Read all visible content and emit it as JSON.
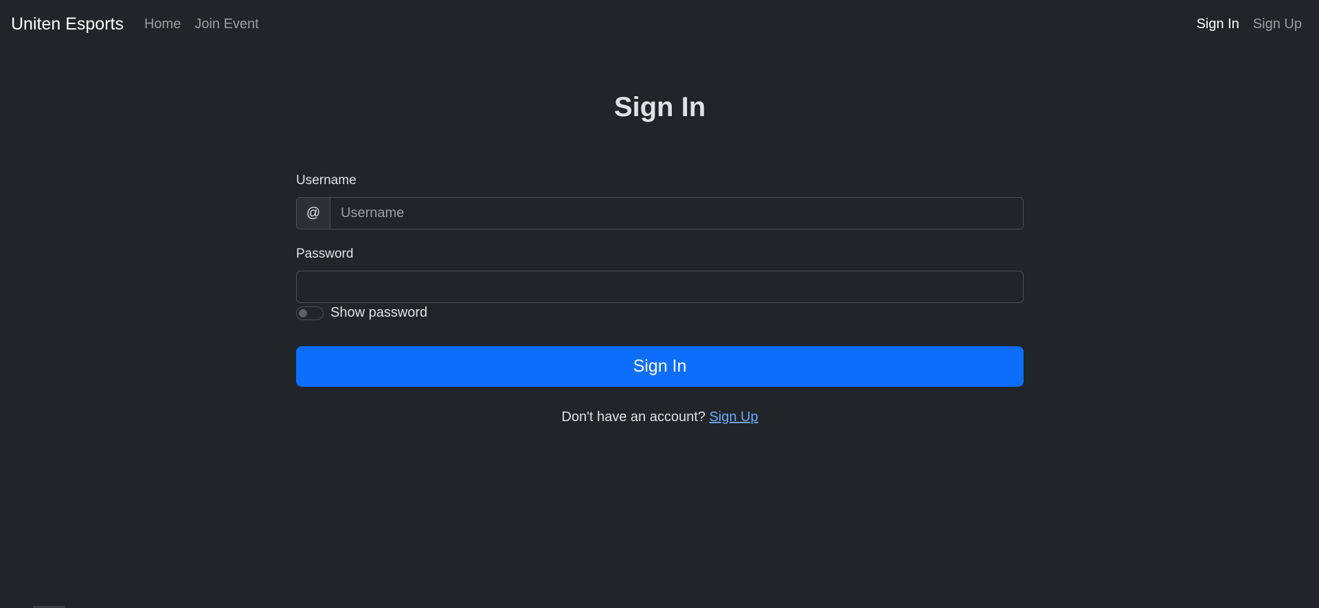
{
  "navbar": {
    "brand": "Uniten Esports",
    "left_links": [
      {
        "label": "Home"
      },
      {
        "label": "Join Event"
      }
    ],
    "right_links": [
      {
        "label": "Sign In",
        "active": true
      },
      {
        "label": "Sign Up",
        "active": false
      }
    ]
  },
  "form": {
    "title": "Sign In",
    "username": {
      "label": "Username",
      "addon": "@",
      "placeholder": "Username",
      "value": ""
    },
    "password": {
      "label": "Password",
      "value": ""
    },
    "show_password": {
      "label": "Show password",
      "checked": false
    },
    "submit_label": "Sign In",
    "signup_prompt": "Don't have an account?",
    "signup_link": "Sign Up"
  },
  "colors": {
    "background": "#212529",
    "primary": "#0d6efd",
    "link": "#6ea8fe",
    "text": "#dee2e6"
  }
}
